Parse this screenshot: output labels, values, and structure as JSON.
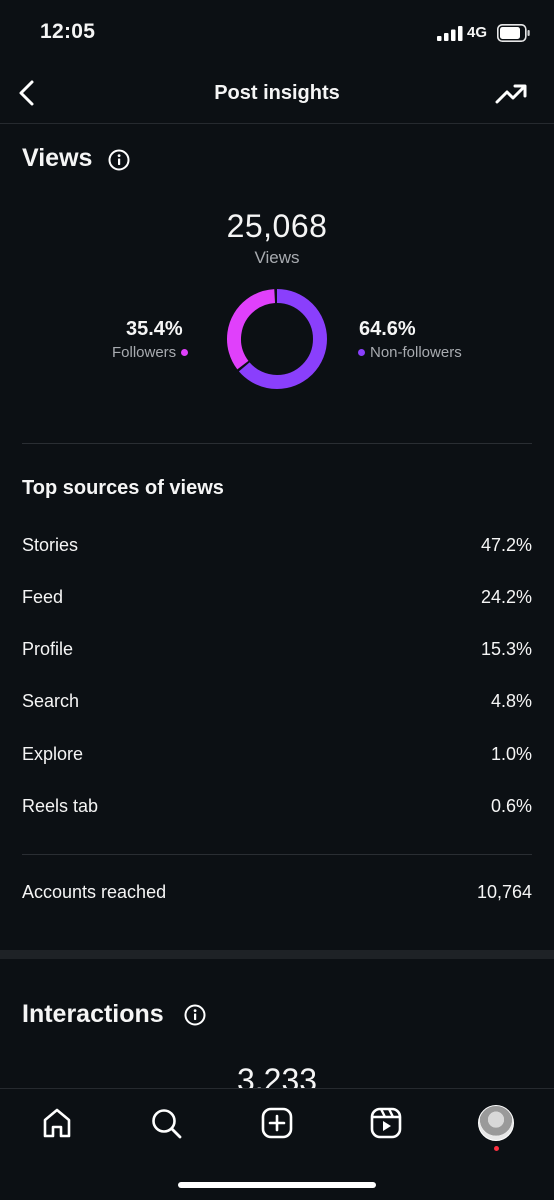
{
  "status_bar": {
    "time": "12:05",
    "network": "4G"
  },
  "header": {
    "title": "Post insights"
  },
  "views": {
    "title": "Views",
    "total": "25,068",
    "total_label": "Views",
    "followers_pct": "35.4%",
    "followers_label": "Followers",
    "non_followers_pct": "64.6%",
    "non_followers_label": "Non-followers",
    "followers_fraction": 0.354,
    "colors": {
      "followers": "#e040fb",
      "non_followers": "#8a3ffc"
    }
  },
  "top_sources": {
    "title": "Top sources of views",
    "items": [
      {
        "label": "Stories",
        "value": "47.2%"
      },
      {
        "label": "Feed",
        "value": "24.2%"
      },
      {
        "label": "Profile",
        "value": "15.3%"
      },
      {
        "label": "Search",
        "value": "4.8%"
      },
      {
        "label": "Explore",
        "value": "1.0%"
      },
      {
        "label": "Reels tab",
        "value": "0.6%"
      }
    ]
  },
  "accounts_reached": {
    "label": "Accounts reached",
    "value": "10,764"
  },
  "interactions": {
    "title": "Interactions",
    "total": "3,233"
  },
  "bottom_nav": {
    "icons": [
      "home-icon",
      "search-icon",
      "create-icon",
      "reels-icon",
      "profile-avatar"
    ]
  }
}
